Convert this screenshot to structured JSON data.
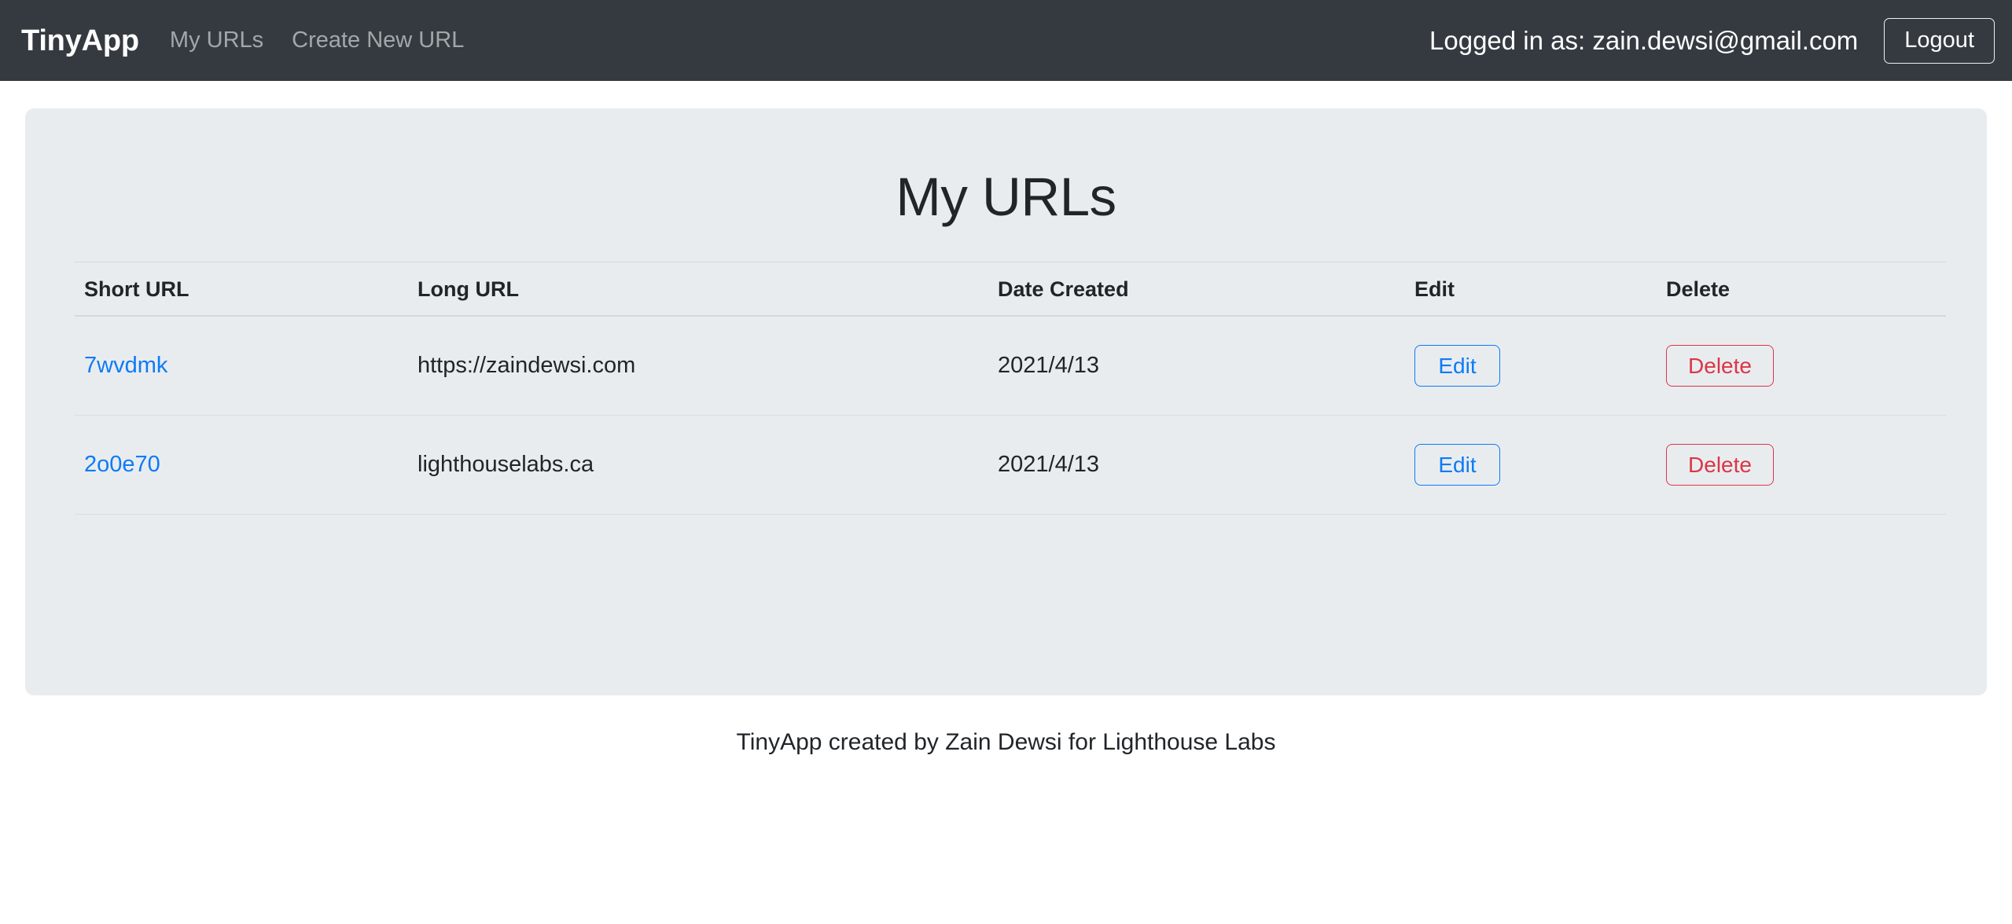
{
  "navbar": {
    "brand": "TinyApp",
    "links": [
      {
        "label": "My URLs"
      },
      {
        "label": "Create New URL"
      }
    ],
    "logged_in_text": "Logged in as: zain.dewsi@gmail.com",
    "logout_label": "Logout"
  },
  "main": {
    "title": "My URLs",
    "table": {
      "headers": [
        "Short URL",
        "Long URL",
        "Date Created",
        "Edit",
        "Delete"
      ],
      "rows": [
        {
          "short_url": "7wvdmk",
          "long_url": "https://zaindewsi.com",
          "date_created": "2021/4/13",
          "edit_label": "Edit",
          "delete_label": "Delete"
        },
        {
          "short_url": "2o0e70",
          "long_url": "lighthouselabs.ca",
          "date_created": "2021/4/13",
          "edit_label": "Edit",
          "delete_label": "Delete"
        }
      ]
    }
  },
  "footer": {
    "text": "TinyApp created by Zain Dewsi for Lighthouse Labs"
  },
  "colors": {
    "navbar_bg": "#343a40",
    "panel_bg": "#e9ecef",
    "page_bg": "#ffffff",
    "link_blue": "#0d7bf7",
    "danger_red": "#dc3545",
    "text_dark": "#212529"
  }
}
